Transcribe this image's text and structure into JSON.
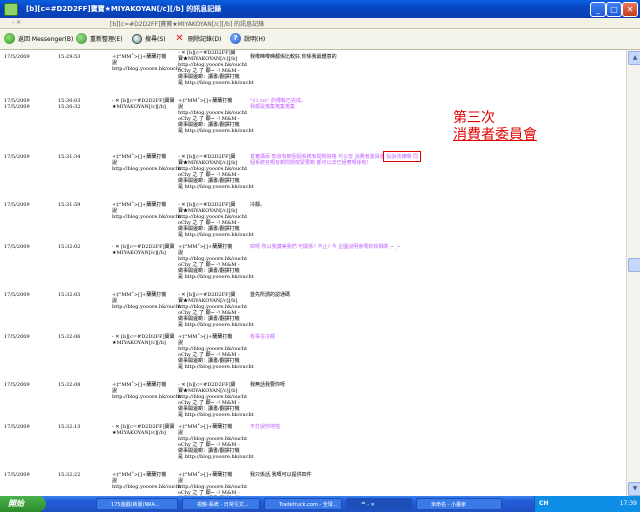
{
  "window": {
    "title": "[b][c=#D2D2FF]寶寶★MIYAKOYAN[/c][/b] 的訊息記錄",
    "infobar": {
      "back_glyph": "- ✕",
      "caption": "[b][c=#D2D2FF]寶寶★MIYAKOYAN[/c][/b] 的訊息記錄"
    },
    "controls": {
      "minimize": "_",
      "maximize": "□",
      "close": "✕"
    }
  },
  "toolbar": {
    "back": "返回 Messenger(B)",
    "refresh": "重新整理(E)",
    "find": "搜尋(S)",
    "delete": "刪除記錄(D)",
    "help": "說明(H)"
  },
  "sender": {
    "pink": "- ✕ [b][c=#D2D2FF]寶寶\n★MIYAKOYAN[/c][/b]",
    "link": "http://blog.yooore.hk/oucht"
  },
  "receiver": {
    "nick": "+‡°MM˚>[]+蘭蘭打機\n說\nhttp://blog.yooore.hk/oucht",
    "long": "- ✕ [b][c=#D2D2FF]寶\n寶★MIYAKOYAN[/c][/b]\nhttp://blog.yooore.hk/oucht\noChy 之 了 願~ -! M&M -\n做事開邊啲：讀書/翻譯打機\n是 http://blog.yooore.hk/oucht",
    "mid": "+‡°MM˚>[]+蘭蘭打機\n說\nhttp://blog.yooore.hk/oucht\noChy 之 了 願~ -! M&M -\n做事開邊啲：讀書/翻譯打機\n是 http://blog.yooore.hk/oucht"
  },
  "messages": [
    {
      "date": "17/5/2009",
      "time": "15:29:53",
      "text": "我嚟睇嚟睇都係比較好,你係我最鍾意的",
      "purple": false
    },
    {
      "date": "17/5/2009\n17/5/2009",
      "time": "15:30:03\n15:30:32",
      "text": "\"01.txt\" 的傳輸已完成。\n我都是蒐集蒐集蒐集",
      "purple": true
    },
    {
      "date": "17/5/2009",
      "time": "15:31:34",
      "text": "其實講兩 知道有啲個個系統有問題資格 可以去 消費者委員會 投訴法律啲 同\n個系統名嘅有啲問題咁緊要啲 都可以去已經應嘅係啦!",
      "purple": true
    },
    {
      "date": "17/5/2009",
      "time": "15:31:59",
      "text": "冷靜。",
      "purple": false
    },
    {
      "date": "17/5/2009",
      "time": "15:32:02",
      "text": "咁呀 所以我讚美我們 可開係? 不止? 今 企圖說明會嘅有效相啲 ~_~",
      "purple": true
    },
    {
      "date": "17/5/2009",
      "time": "15:32:03",
      "text": "首先所謂的認通碼",
      "purple": false
    },
    {
      "date": "17/5/2009",
      "time": "15:32:06",
      "text": "有事在冷靜",
      "purple": true
    },
    {
      "date": "17/5/2009",
      "time": "15:32:08",
      "text": "我無話我要你呀",
      "purple": false
    },
    {
      "date": "17/5/2009",
      "time": "15:32:13",
      "text": "不打說你地啦",
      "purple": true
    },
    {
      "date": "17/5/2009",
      "time": "15:32:22",
      "text": "我只係話,我嘅可以提供四件",
      "purple": false
    }
  ],
  "annotation": {
    "line1": "第三次",
    "line2": "消費者委員會"
  },
  "scrollbar": {
    "up": "▲",
    "down": "▼"
  },
  "taskbar": {
    "start": "開始",
    "tasks": [
      "175遊戲(新版)NRA...",
      "視鏡-系統 - 日常引文...",
      "Tradetruck.com - 全球...",
      "ᅋ - ✕",
      "未命名 - 小畫家"
    ],
    "lang": "CH",
    "time": "17:39"
  }
}
